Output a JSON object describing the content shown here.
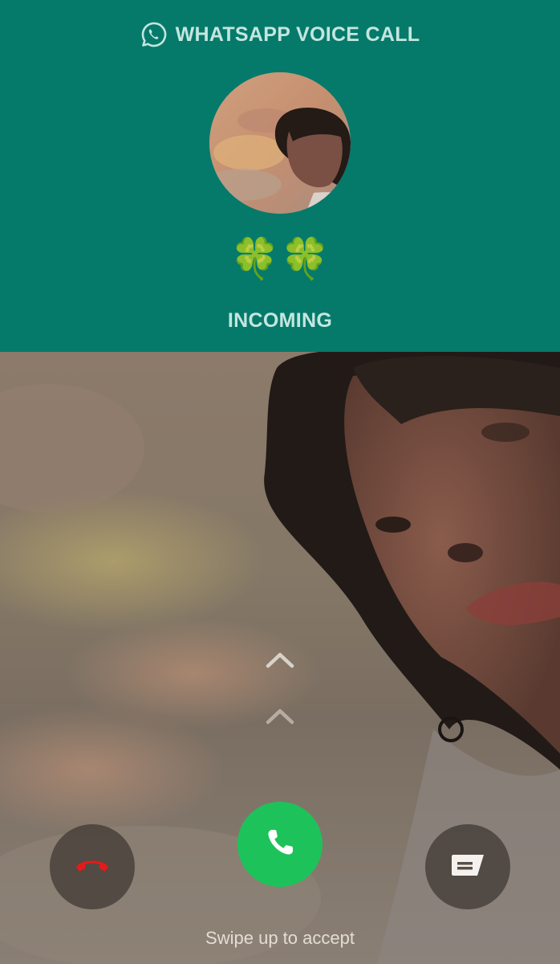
{
  "header": {
    "app_icon": "whatsapp-icon",
    "app_title": "WHATSAPP VOICE CALL",
    "contact_name": "🍀🍀",
    "status": "INCOMING",
    "background_color": "#057a6b"
  },
  "controls": {
    "swipe_icon": "chevron-up-icon",
    "decline_icon": "end-call-icon",
    "accept_icon": "phone-icon",
    "message_icon": "message-icon",
    "accept_color": "#1ec25a",
    "decline_color": "#e21b1b",
    "swipe_hint": "Swipe up to accept"
  }
}
